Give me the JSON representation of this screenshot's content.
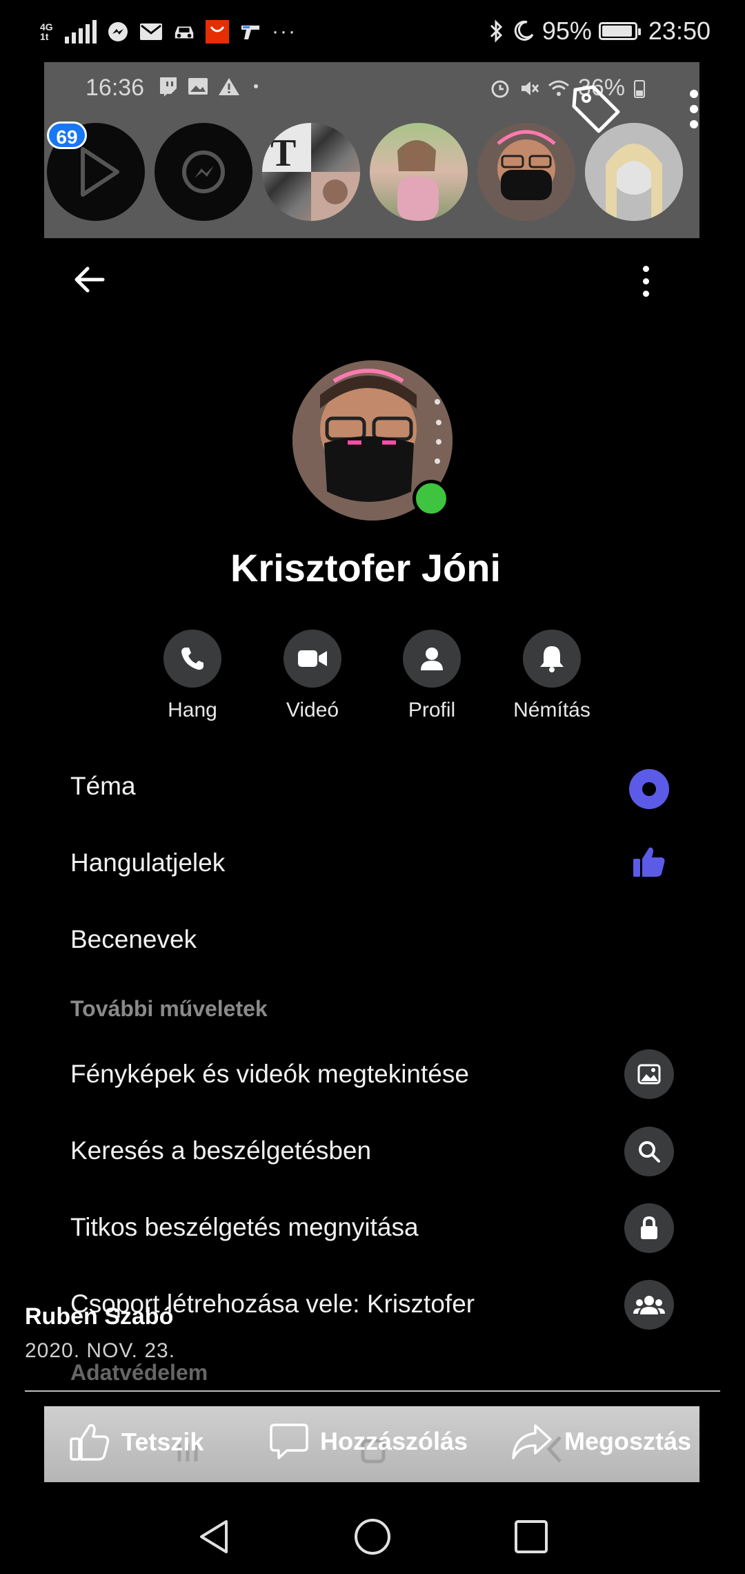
{
  "status_bar": {
    "network": "4G",
    "network_sub": "1t",
    "battery": "95%",
    "battery_level": 0.95,
    "time": "23:50",
    "more": "···",
    "icons": [
      "messenger-icon",
      "gmail-icon",
      "car-icon",
      "aliexpress-icon",
      "gun-icon"
    ]
  },
  "inner_status": {
    "time": "16:36",
    "battery": "36%"
  },
  "chat_heads": {
    "badge": "69"
  },
  "conversation": {
    "name": "Krisztofer Jóni",
    "actions": [
      {
        "label": "Hang",
        "icon": "phone-icon"
      },
      {
        "label": "Videó",
        "icon": "video-icon"
      },
      {
        "label": "Profil",
        "icon": "person-icon"
      },
      {
        "label": "Némítás",
        "icon": "bell-icon"
      }
    ],
    "settings": [
      {
        "label": "Téma",
        "icon": "theme-icon"
      },
      {
        "label": "Hangulatjelek",
        "icon": "thumbs-up-icon"
      },
      {
        "label": "Becenevek"
      }
    ],
    "more_actions_header": "További műveletek",
    "more_actions": [
      {
        "label": "Fényképek és videók megtekintése",
        "icon": "image-icon"
      },
      {
        "label": "Keresés a beszélgetésben",
        "icon": "search-icon"
      },
      {
        "label": "Titkos beszélgetés megnyitása",
        "icon": "lock-icon"
      },
      {
        "label": "Csoport létrehozása vele: Krisztofer",
        "icon": "group-icon"
      }
    ],
    "privacy_header": "Adatvédelem",
    "accent_color": "#5b5be8"
  },
  "post": {
    "author": "Ruben Szabó",
    "date": "2020. NOV. 23."
  },
  "post_actions": {
    "like": "Tetszik",
    "comment": "Hozzászólás",
    "share": "Megosztás"
  }
}
